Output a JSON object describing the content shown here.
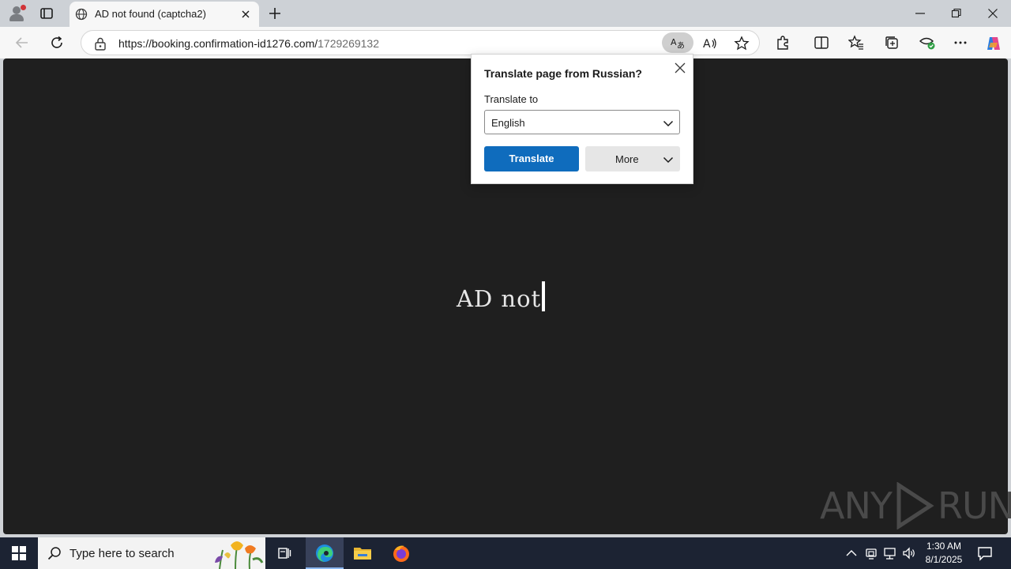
{
  "browser": {
    "tab": {
      "title": "AD not found (captcha2)"
    },
    "address": {
      "host": "https://booking.confirmation-id1276.com/",
      "path": "1729269132"
    }
  },
  "page": {
    "typed_text": "AD not",
    "watermark_left": "ANY",
    "watermark_right": "RUN"
  },
  "translate_popup": {
    "title": "Translate page from Russian?",
    "label": "Translate to",
    "selected_language": "English",
    "translate_button": "Translate",
    "more_button": "More"
  },
  "taskbar": {
    "search_placeholder": "Type here to search",
    "time": "1:30 AM",
    "date": "8/1/2025"
  },
  "colors": {
    "accent": "#0f6cbd",
    "page_background": "#1f1f1f",
    "taskbar": "#1c2333"
  }
}
